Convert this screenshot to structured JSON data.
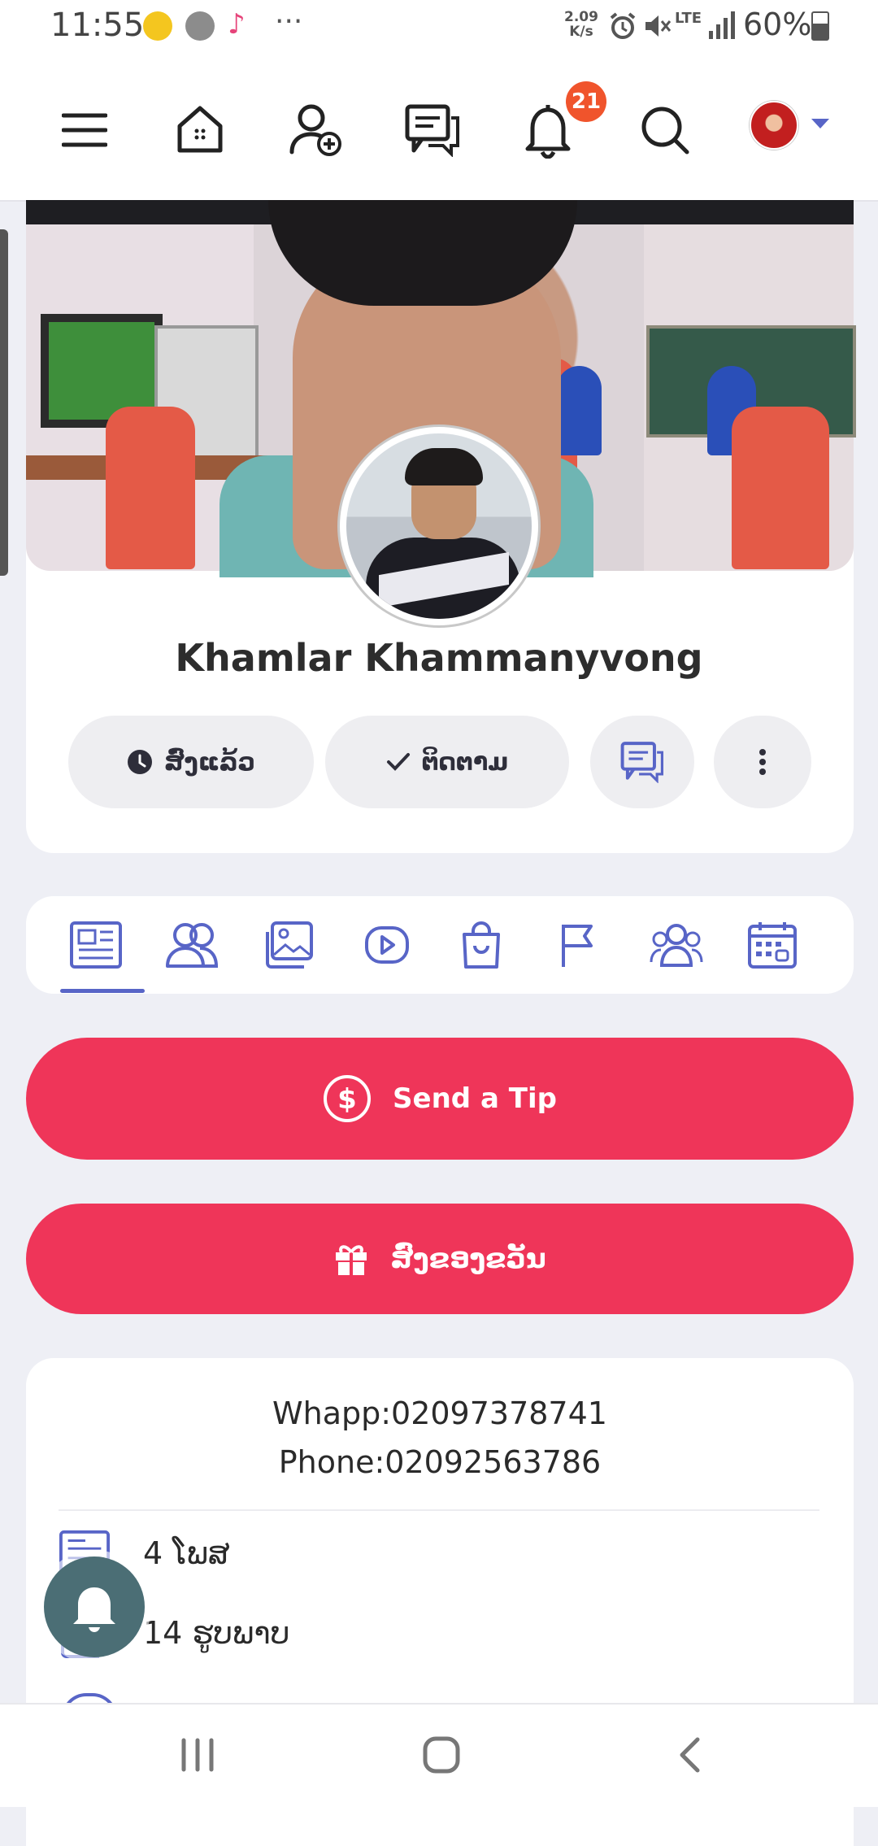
{
  "status_bar": {
    "time": "11:55",
    "dots": "···",
    "net_speed": "2.09\nK/s",
    "network": "LTE",
    "battery": "60%",
    "icons": [
      "yes-app-icon",
      "line-icon",
      "tiktok-icon",
      "alarm-icon",
      "mute-icon",
      "lte-icon",
      "signal-icon",
      "battery-icon"
    ]
  },
  "top_nav": {
    "icons": [
      "menu-icon",
      "home-icon",
      "add-friend-icon",
      "messages-icon",
      "notifications-icon",
      "search-icon",
      "avatar"
    ],
    "notification_count": "21"
  },
  "profile": {
    "name": "Khamlar Khammanyvong",
    "buttons": {
      "poked": "ສົ່ງແລ້ວ",
      "following": "ຕິດຕາມ"
    }
  },
  "tabs": [
    "posts-tab",
    "friends-tab",
    "photos-tab",
    "videos-tab",
    "products-tab",
    "pages-tab",
    "groups-tab",
    "events-tab"
  ],
  "actions": {
    "tip": "Send a Tip",
    "gift": "ສົ່ງຂອງຂວັນ"
  },
  "info": {
    "whatsapp": "Whapp:02097378741",
    "phone": "Phone:02092563786",
    "stats": [
      {
        "count": "4",
        "label": "ໂພສ",
        "text": "4 ໂພສ"
      },
      {
        "count": "14",
        "label": "ຮູບພາບ",
        "text": "14 ຮູບພາບ"
      }
    ]
  },
  "colors": {
    "accent": "#5865c7",
    "action_red": "#ef3559",
    "badge": "#f0542c"
  }
}
